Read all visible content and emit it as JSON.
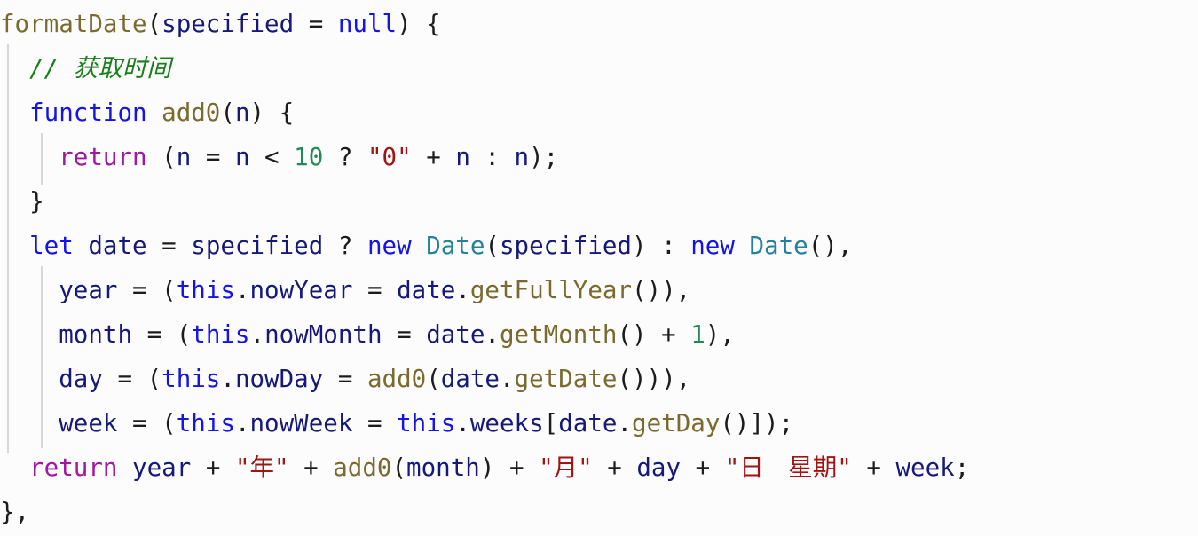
{
  "editor": {
    "language": "javascript",
    "background": "#fcfcfc",
    "indent_guide_color": "#d8d8d8",
    "theme_colors": {
      "function": "#7a6a2e",
      "variable": "#16197a",
      "keyword": "#1414e8",
      "return_keyword": "#a018a0",
      "class": "#23829b",
      "number": "#1f8a55",
      "string": "#a11414",
      "comment": "#1a7f1a",
      "punctuation": "#1c1c1c"
    }
  },
  "code": {
    "line1": {
      "fn_name": "formatDate",
      "paren_open": "(",
      "param": "specified",
      "equals": " = ",
      "null_kw": "null",
      "paren_close": ")",
      "brace": " {"
    },
    "line2": {
      "indent": "  ",
      "comment": "// 获取时间"
    },
    "line3": {
      "indent": "  ",
      "keyword": "function",
      "space": " ",
      "fn_name": "add0",
      "paren_open": "(",
      "param": "n",
      "paren_close": ")",
      "brace": " {"
    },
    "line4": {
      "indent": "    ",
      "return_kw": "return",
      "p1": " (",
      "v_n1": "n",
      "op1": " = ",
      "v_n2": "n",
      "op2": " < ",
      "num": "10",
      "op3": " ? ",
      "str": "\"0\"",
      "op4": " + ",
      "v_n3": "n",
      "op5": " : ",
      "v_n4": "n",
      "end": ");"
    },
    "line5": {
      "indent": "  ",
      "brace": "}"
    },
    "line6": {
      "indent": "  ",
      "keyword": "let",
      "sp1": " ",
      "v_date": "date",
      "op1": " = ",
      "v_specified": "specified",
      "op2": " ? ",
      "new_kw1": "new",
      "sp2": " ",
      "class1": "Date",
      "p1": "(",
      "v_specified2": "specified",
      "p2": ")",
      "op3": " : ",
      "new_kw2": "new",
      "sp3": " ",
      "class2": "Date",
      "end": "(),"
    },
    "line7": {
      "indent": "    ",
      "v_year": "year",
      "op1": " = (",
      "this_kw": "this",
      "dot1": ".",
      "prop": "nowYear",
      "op2": " = ",
      "v_date": "date",
      "dot2": ".",
      "method": "getFullYear",
      "end": "()),"
    },
    "line8": {
      "indent": "    ",
      "v_month": "month",
      "op1": " = (",
      "this_kw": "this",
      "dot1": ".",
      "prop": "nowMonth",
      "op2": " = ",
      "v_date": "date",
      "dot2": ".",
      "method": "getMonth",
      "op3": "() + ",
      "num": "1",
      "end": "),"
    },
    "line9": {
      "indent": "    ",
      "v_day": "day",
      "op1": " = (",
      "this_kw": "this",
      "dot1": ".",
      "prop": "nowDay",
      "op2": " = ",
      "fn_add0": "add0",
      "p1": "(",
      "v_date": "date",
      "dot2": ".",
      "method": "getDate",
      "end": "())),"
    },
    "line10": {
      "indent": "    ",
      "v_week": "week",
      "op1": " = (",
      "this_kw1": "this",
      "dot1": ".",
      "prop1": "nowWeek",
      "op2": " = ",
      "this_kw2": "this",
      "dot2": ".",
      "prop2": "weeks",
      "bracket1": "[",
      "v_date": "date",
      "dot3": ".",
      "method": "getDay",
      "end": "()]);"
    },
    "line11": {
      "indent": "  ",
      "return_kw": "return",
      "sp": " ",
      "v_year": "year",
      "op1": " + ",
      "str_year": "\"年\"",
      "op2": " + ",
      "fn_add0": "add0",
      "p1": "(",
      "v_month": "month",
      "p2": ")",
      "op3": " + ",
      "str_month": "\"月\"",
      "op4": " + ",
      "v_day": "day",
      "op5": " + ",
      "str_day": "\"日　星期\"",
      "op6": " + ",
      "v_week": "week",
      "end": ";"
    },
    "line12": {
      "brace": "},"
    }
  }
}
